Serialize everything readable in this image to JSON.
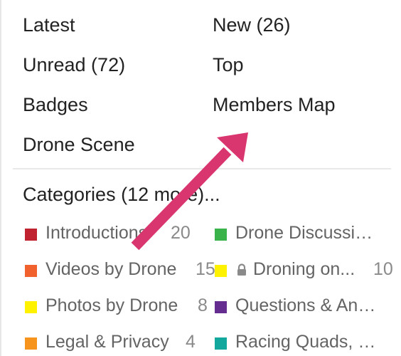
{
  "nav": {
    "latest": "Latest",
    "new": "New (26)",
    "unread": "Unread (72)",
    "top": "Top",
    "badges": "Badges",
    "members_map": "Members Map",
    "drone_scene": "Drone Scene"
  },
  "categories": {
    "heading": "Categories (12 more)...",
    "items": [
      {
        "name": "Introductions",
        "count": "20",
        "color": "#c0222f"
      },
      {
        "name": "Drone Discussi…",
        "count": "",
        "color": "#3ab44a"
      },
      {
        "name": "Videos by Drone",
        "count": "15",
        "color": "#f0612d"
      },
      {
        "name": "Droning on...",
        "count": "10",
        "color": "#fff200",
        "locked": true
      },
      {
        "name": "Photos by Drone",
        "count": "8",
        "color": "#fff200"
      },
      {
        "name": "Questions & An…",
        "count": "",
        "color": "#652d90"
      },
      {
        "name": "Legal & Privacy",
        "count": "4",
        "color": "#f7941d"
      },
      {
        "name": "Racing Quads, …",
        "count": "",
        "color": "#12a89d"
      }
    ]
  },
  "annotation": {
    "color": "#d9356f",
    "icon": "arrow-icon"
  }
}
